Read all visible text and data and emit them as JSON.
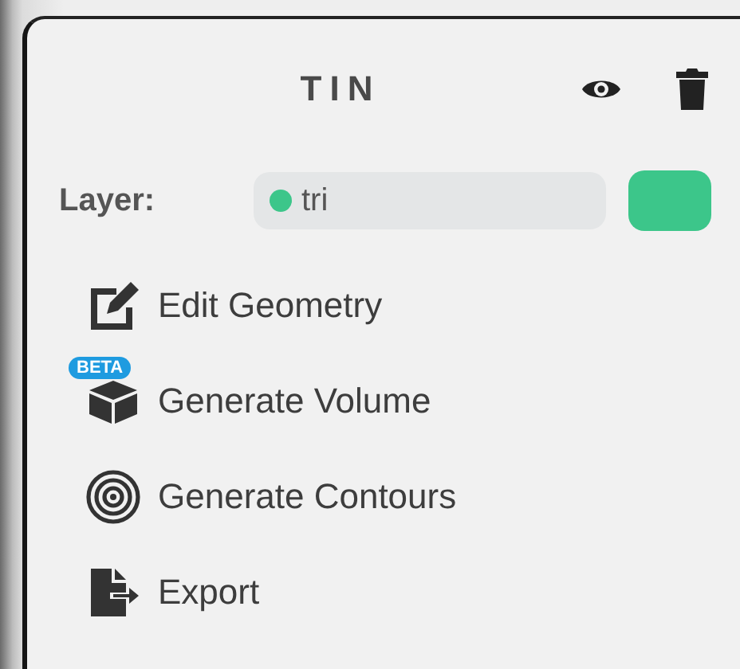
{
  "panel": {
    "title": "TIN"
  },
  "layer": {
    "label": "Layer:",
    "value": "tri",
    "color": "#3cc68a"
  },
  "actions": [
    {
      "kind": "edit",
      "label": "Edit Geometry"
    },
    {
      "kind": "volume",
      "label": "Generate Volume",
      "badge": "BETA"
    },
    {
      "kind": "contours",
      "label": "Generate Contours"
    },
    {
      "kind": "export",
      "label": "Export"
    }
  ]
}
